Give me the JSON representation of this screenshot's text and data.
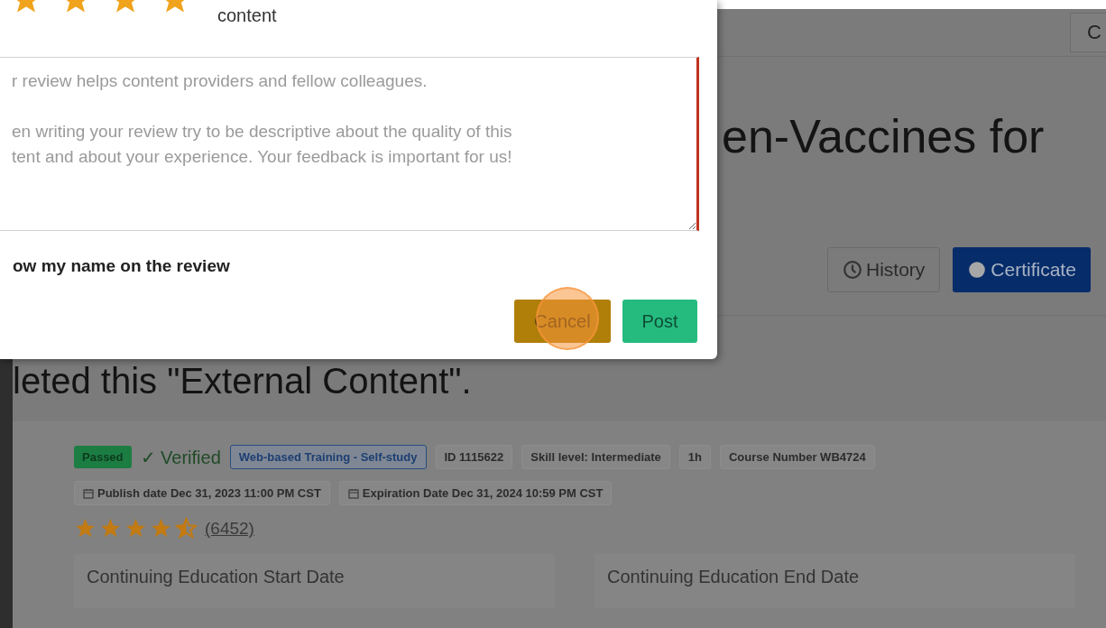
{
  "modal": {
    "rating": {
      "stars": 4,
      "label": "content"
    },
    "review": {
      "placeholder": "r review helps content providers and fellow colleagues.\n\nen writing your review try to be descriptive about the quality of this\ntent and about your experience. Your feedback is important for us!"
    },
    "show_name": {
      "label": "ow my name on the review"
    },
    "buttons": [
      {
        "label": "Cancel",
        "kind": "cancel"
      },
      {
        "label": "Post",
        "kind": "post"
      }
    ]
  },
  "page": {
    "top_button": "C",
    "title": "en-Vaccines for",
    "actions": [
      {
        "label": "History",
        "kind": "history"
      },
      {
        "label": "Certificate",
        "kind": "certificate"
      }
    ],
    "completion_heading": "leted this \"External Content\".",
    "badges": [
      {
        "label": "Passed",
        "kind": "status"
      },
      {
        "label": "✓ Verified",
        "kind": "verified"
      },
      {
        "label": "Web-based Training - Self-study",
        "kind": "type"
      },
      {
        "label": "ID 1115622",
        "kind": "chip"
      },
      {
        "label": "Skill level: Intermediate",
        "kind": "chip"
      },
      {
        "label": "1h",
        "kind": "chip"
      },
      {
        "label": "Course Number WB4724",
        "kind": "chip"
      }
    ],
    "dates": [
      {
        "label": "Publish date Dec 31, 2023 11:00 PM CST"
      },
      {
        "label": "Expiration Date Dec 31, 2024 10:59 PM CST"
      }
    ],
    "rating": {
      "stars": 4.5,
      "count": "(6452)"
    },
    "info": [
      {
        "label": "Continuing Education Start Date"
      },
      {
        "label": "Continuing Education End Date"
      }
    ]
  }
}
